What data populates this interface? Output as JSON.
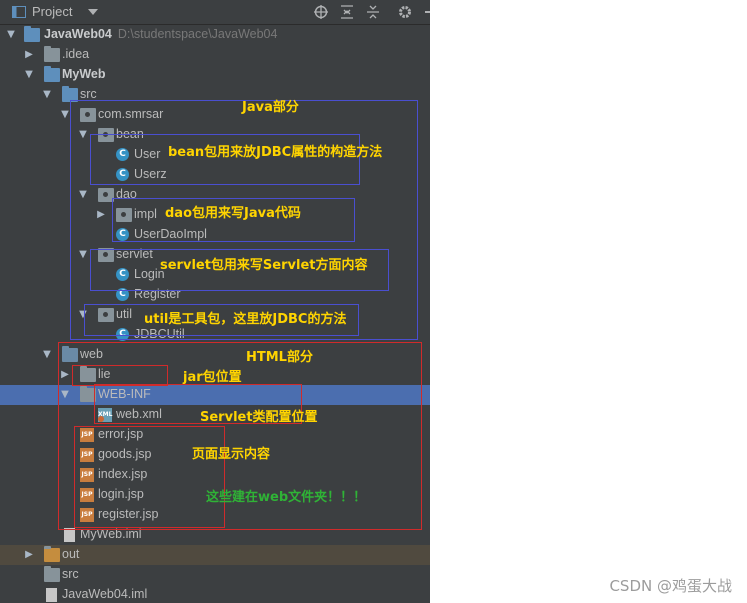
{
  "header": {
    "title": "Project",
    "icons": [
      "project-view-icon",
      "dropdown-icon",
      "locate-icon",
      "expand-all-icon",
      "collapse-all-icon",
      "settings-icon",
      "hide-icon"
    ]
  },
  "tree": {
    "root": {
      "label": "JavaWeb04",
      "path": "D:\\studentspace\\JavaWeb04"
    },
    "idea": ".idea",
    "myweb": "MyWeb",
    "src": "src",
    "com_smrsar": "com.smrsar",
    "bean": "bean",
    "user": "User",
    "userz": "Userz",
    "dao": "dao",
    "impl": "impl",
    "userdaoimpl": "UserDaoImpl",
    "servlet": "servlet",
    "login": "Login",
    "register": "Register",
    "util": "util",
    "jdbcutil": "JDBCUtil",
    "web": "web",
    "lie": "lie",
    "webinf": "WEB-INF",
    "webxml": "web.xml",
    "error_jsp": "error.jsp",
    "goods_jsp": "goods.jsp",
    "index_jsp": "index.jsp",
    "login_jsp": "login.jsp",
    "register_jsp": "register.jsp",
    "myweb_iml": "MyWeb.iml",
    "out": "out",
    "src2": "src",
    "javaweb04_iml": "JavaWeb04.iml"
  },
  "annotations": {
    "java_part": "Java部分",
    "bean_note": "bean包用来放JDBC属性的构造方法",
    "dao_note": "dao包用来写Java代码",
    "servlet_note": "servlet包用来写Servlet方面内容",
    "util_note": "util是工具包，这里放JDBC的方法",
    "html_part": "HTML部分",
    "jar_note": "jar包位置",
    "servlet_config_note": "Servlet类配置位置",
    "page_note": "页面显示内容",
    "web_folder_note": "这些建在web文件夹！！！"
  },
  "colors": {
    "annotation_yellow": "#ffd400",
    "annotation_green": "#2fb336",
    "box_blue": "#4a4fd0",
    "box_red": "#d02b2b",
    "selection": "#4b6eaf"
  },
  "watermark": "CSDN @鸡蛋大战"
}
